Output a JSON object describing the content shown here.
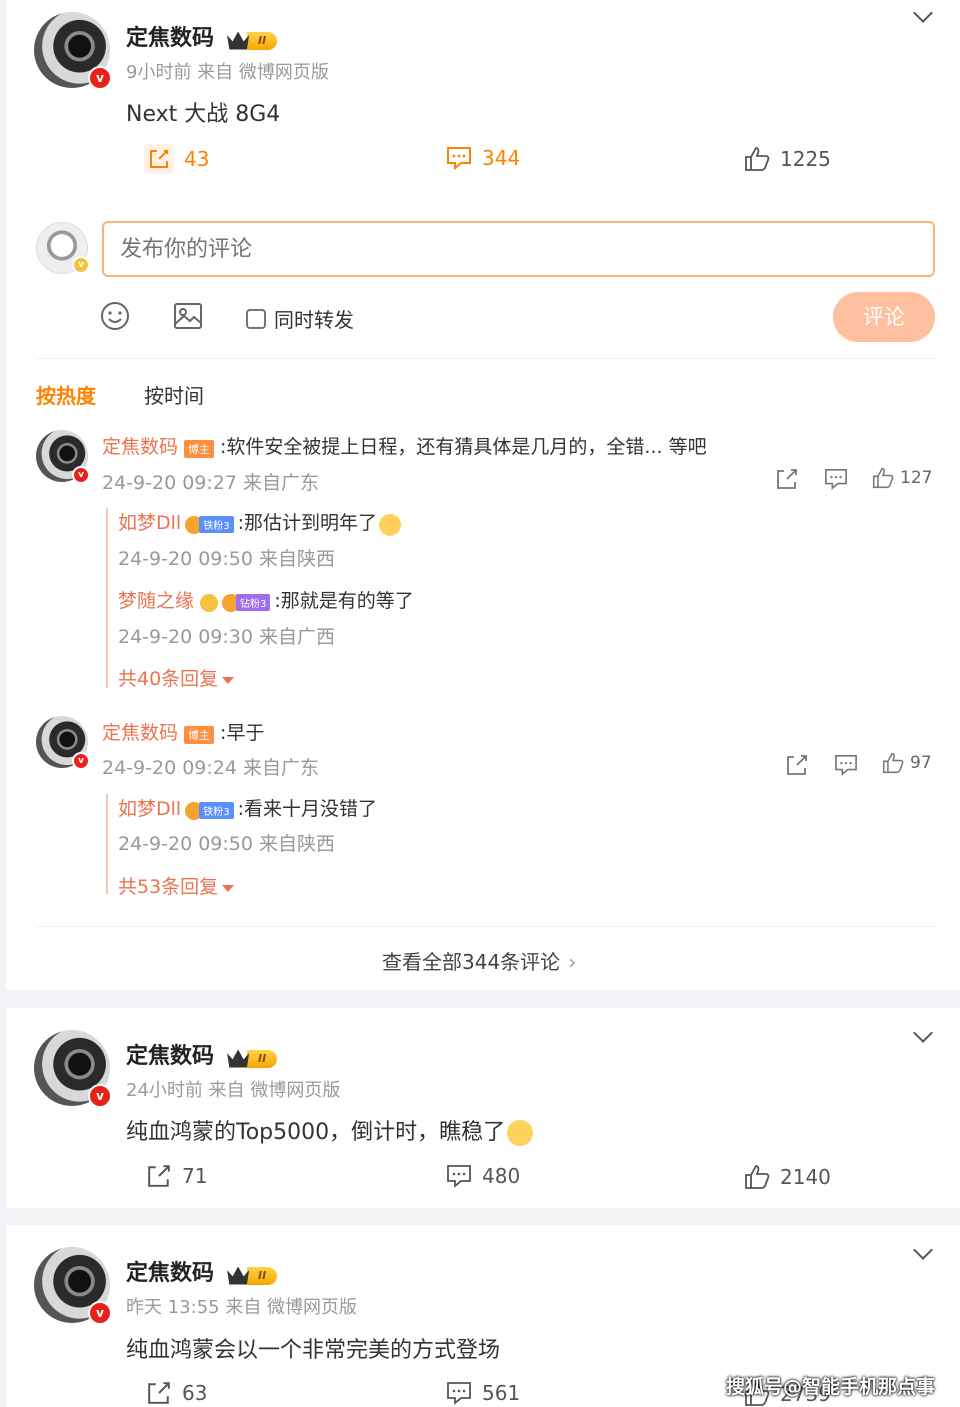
{
  "post1": {
    "author": "定焦数码",
    "vip_level": "II",
    "meta": "9小时前 来自 微博网页版",
    "content": "Next 大战 8G4",
    "reposts": "43",
    "comments": "344",
    "likes": "1225"
  },
  "composer": {
    "placeholder": "发布你的评论",
    "also_repost_label": "同时转发",
    "submit_label": "评论"
  },
  "sort": {
    "hot": "按热度",
    "time": "按时间"
  },
  "comments": [
    {
      "name": "定焦数码",
      "tag": "博主",
      "text": ":软件安全被提上日程，还有猜具体是几月的，全错... 等吧",
      "time": "24-9-20 09:27 来自广东",
      "likes": "127",
      "replies": [
        {
          "name": "如梦Dll",
          "fan": "铁粉3",
          "text": ":那估计到明年了",
          "time": "24-9-20 09:50 来自陕西"
        },
        {
          "name": "梦随之缘",
          "fan": "钻粉3",
          "text": ":那就是有的等了",
          "time": "24-9-20 09:30 来自广西"
        }
      ],
      "more": "共40条回复"
    },
    {
      "name": "定焦数码",
      "tag": "博主",
      "text": ":早于",
      "time": "24-9-20 09:24 来自广东",
      "likes": "97",
      "replies": [
        {
          "name": "如梦Dll",
          "fan": "铁粉3",
          "text": ":看来十月没错了",
          "time": "24-9-20 09:50 来自陕西"
        }
      ],
      "more": "共53条回复"
    }
  ],
  "view_all": "查看全部344条评论",
  "post2": {
    "author": "定焦数码",
    "vip_level": "II",
    "meta": "24小时前 来自 微博网页版",
    "content": "纯血鸿蒙的Top5000，倒计时，瞧稳了",
    "reposts": "71",
    "comments": "480",
    "likes": "2140"
  },
  "post3": {
    "author": "定焦数码",
    "vip_level": "II",
    "meta": "昨天 13:55 来自 微博网页版",
    "content": "纯血鸿蒙会以一个非常完美的方式登场",
    "reposts": "63",
    "comments": "561",
    "likes": "2739"
  },
  "watermark": "搜狐号@智能手机那点事",
  "colors": {
    "accent": "#ff8200",
    "name_link": "#eb7350",
    "verified_red": "#e8211a",
    "submit_bg": "#ffc09f"
  }
}
